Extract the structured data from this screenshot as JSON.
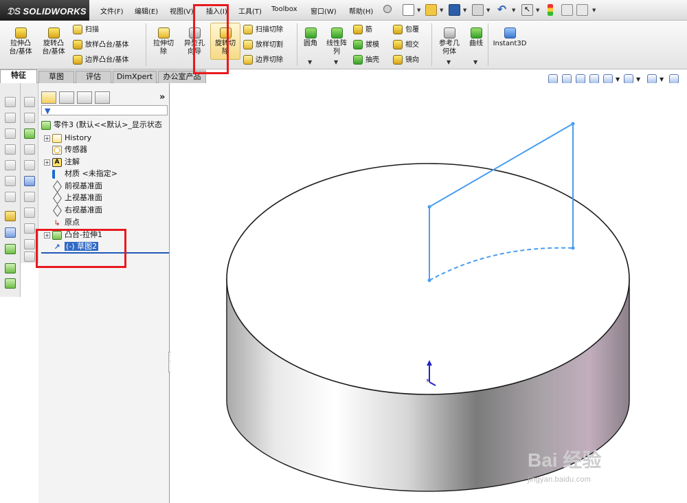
{
  "app": {
    "logo_prefix": "𝔇S",
    "logo_text": "SOLIDWORKS"
  },
  "menubar": {
    "file": "文件(F)",
    "edit": "编辑(E)",
    "view": "视图(V)",
    "insert": "插入(I)",
    "tools": "工具(T)",
    "toolbox": "Toolbox",
    "window": "窗口(W)",
    "help": "帮助(H)"
  },
  "commandmanager": {
    "extrude_boss": "拉伸凸\n台/基体",
    "revolve_boss": "旋转凸\n台/基体",
    "swept_boss": "扫描",
    "loft_boss": "放样凸台/基体",
    "boundary_boss": "边界凸台/基体",
    "extrude_cut": "拉伸切\n除",
    "hole_wizard": "异型孔\n向导",
    "revolve_cut": "旋转切\n除",
    "swept_cut": "扫描切除",
    "loft_cut": "放样切割",
    "boundary_cut": "边界切除",
    "fillet": "圆角",
    "linear_pattern": "线性阵\n列",
    "rib": "筋",
    "draft": "拔模",
    "shell": "抽壳",
    "wrap": "包覆",
    "intersect": "相交",
    "mirror": "镜向",
    "ref_geometry": "参考几\n何体",
    "curves": "曲线",
    "instant3d": "Instant3D"
  },
  "tabs": {
    "features": "特征",
    "sketch": "草图",
    "evaluate": "评估",
    "dimxpert": "DimXpert",
    "office": "办公室产品"
  },
  "featuretree": {
    "root": "零件3 (默认<<默认>_显示状态",
    "history": "History",
    "sensors": "传感器",
    "annotations": "注解",
    "material": "材质 <未指定>",
    "front_plane": "前视基准面",
    "top_plane": "上视基准面",
    "right_plane": "右视基准面",
    "origin": "原点",
    "boss_extrude": "凸台-拉伸1",
    "sketch2": "(-) 草图2"
  },
  "watermark": {
    "brand": "Bai 经验",
    "url": "jingyan.baidu.com"
  },
  "colors": {
    "highlight_box": "#e8191e",
    "sketch_line": "#4a9df0",
    "selection": "#316ac5"
  }
}
